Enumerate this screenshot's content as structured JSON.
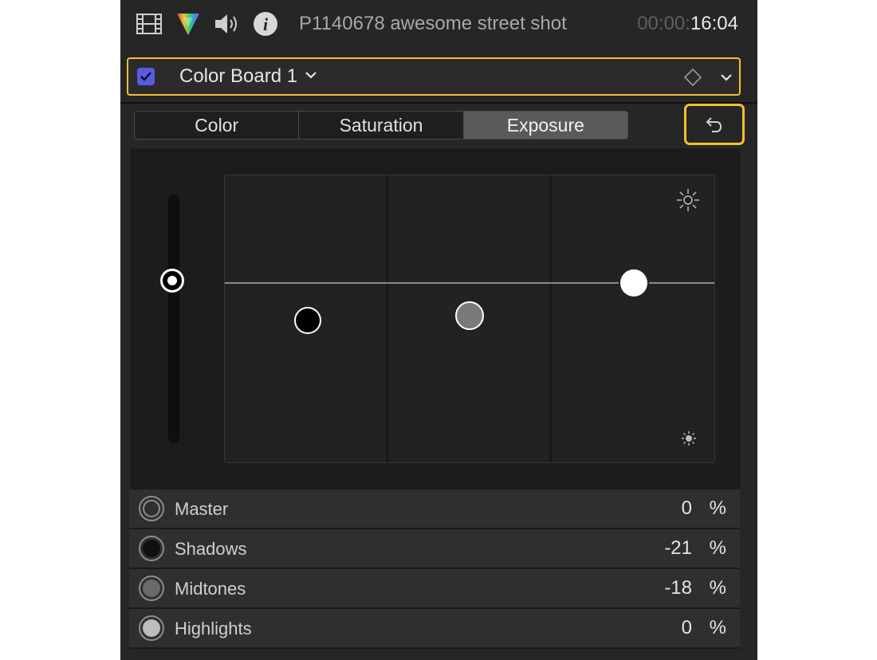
{
  "header": {
    "clip_name": "P1140678 awesome street shot",
    "timecode_dim": "00:00:",
    "timecode_bright": "16:04",
    "icons": [
      "film-inspector-icon",
      "color-inspector-icon",
      "audio-inspector-icon",
      "info-inspector-icon"
    ]
  },
  "effect": {
    "enabled": true,
    "name": "Color Board 1",
    "accent_color": "#f5c02f",
    "checkbox_color": "#5a5ae6"
  },
  "tabs": [
    {
      "label": "Color",
      "active": false
    },
    {
      "label": "Saturation",
      "active": false
    },
    {
      "label": "Exposure",
      "active": true
    }
  ],
  "board": {
    "master_value": 0,
    "pucks": [
      {
        "name": "Shadows",
        "value": -21,
        "color": "#000000"
      },
      {
        "name": "Midtones",
        "value": -18,
        "color": "#7a7a7a"
      },
      {
        "name": "Highlights",
        "value": 0,
        "color": "#ffffff"
      }
    ]
  },
  "rows": [
    {
      "label": "Master",
      "value": "0",
      "unit": "%"
    },
    {
      "label": "Shadows",
      "value": "-21",
      "unit": "%"
    },
    {
      "label": "Midtones",
      "value": "-18",
      "unit": "%"
    },
    {
      "label": "Highlights",
      "value": "0",
      "unit": "%"
    }
  ]
}
